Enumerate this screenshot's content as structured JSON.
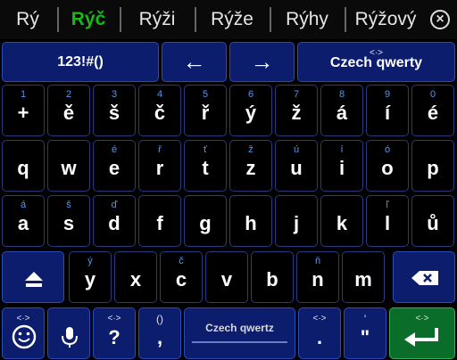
{
  "suggestions": [
    {
      "text": "Rý",
      "highlight": false
    },
    {
      "text": "Rýč",
      "highlight": true
    },
    {
      "text": "Rýži",
      "highlight": false
    },
    {
      "text": "Rýže",
      "highlight": false
    },
    {
      "text": "Rýhy",
      "highlight": false
    },
    {
      "text": "Rýžový",
      "highlight": false
    }
  ],
  "suggestion_close_icon": "close-icon",
  "top_row": {
    "symbols_label": "123!#()",
    "left_arrow": "←",
    "right_arrow": "→",
    "layout_hint": "<·>",
    "layout_label": "Czech qwerty"
  },
  "number_row": [
    {
      "hint": "1",
      "main": "+"
    },
    {
      "hint": "2",
      "main": "ě"
    },
    {
      "hint": "3",
      "main": "š"
    },
    {
      "hint": "4",
      "main": "č"
    },
    {
      "hint": "5",
      "main": "ř"
    },
    {
      "hint": "6",
      "main": "ý"
    },
    {
      "hint": "7",
      "main": "ž"
    },
    {
      "hint": "8",
      "main": "á"
    },
    {
      "hint": "9",
      "main": "í"
    },
    {
      "hint": "0",
      "main": "é"
    }
  ],
  "row1": [
    {
      "hint": "",
      "main": "q"
    },
    {
      "hint": "",
      "main": "w"
    },
    {
      "hint": "é",
      "main": "e"
    },
    {
      "hint": "ř",
      "main": "r"
    },
    {
      "hint": "ť",
      "main": "t"
    },
    {
      "hint": "ž",
      "main": "z"
    },
    {
      "hint": "ú",
      "main": "u"
    },
    {
      "hint": "í",
      "main": "i"
    },
    {
      "hint": "ó",
      "main": "o"
    },
    {
      "hint": "",
      "main": "p"
    }
  ],
  "row2": [
    {
      "hint": "á",
      "main": "a"
    },
    {
      "hint": "š",
      "main": "s"
    },
    {
      "hint": "ď",
      "main": "d"
    },
    {
      "hint": "",
      "main": "f"
    },
    {
      "hint": "",
      "main": "g"
    },
    {
      "hint": "",
      "main": "h"
    },
    {
      "hint": "",
      "main": "j"
    },
    {
      "hint": "",
      "main": "k"
    },
    {
      "hint": "ľ",
      "main": "l"
    },
    {
      "hint": "",
      "main": "ů"
    }
  ],
  "row3": [
    {
      "hint": "ý",
      "main": "y"
    },
    {
      "hint": "",
      "main": "x"
    },
    {
      "hint": "č",
      "main": "c"
    },
    {
      "hint": "",
      "main": "v"
    },
    {
      "hint": "",
      "main": "b"
    },
    {
      "hint": "ň",
      "main": "n"
    },
    {
      "hint": "",
      "main": "m"
    }
  ],
  "bottom_row": {
    "emoji_hint": "<·>",
    "question_hint": "<·>",
    "question_main": "?",
    "comma_hint": "()",
    "comma_main": ",",
    "space_label": "Czech qwertz",
    "period_hint": "<·>",
    "period_main": ".",
    "quote_hint": "'",
    "quote_main": "\"",
    "enter_hint": "<·>"
  },
  "colors": {
    "function_key": "#0c1d6e",
    "letter_key": "#000000",
    "enter_key": "#0a6d2a",
    "hint_text": "#5b94e8",
    "suggestion_highlight": "#18b818"
  }
}
